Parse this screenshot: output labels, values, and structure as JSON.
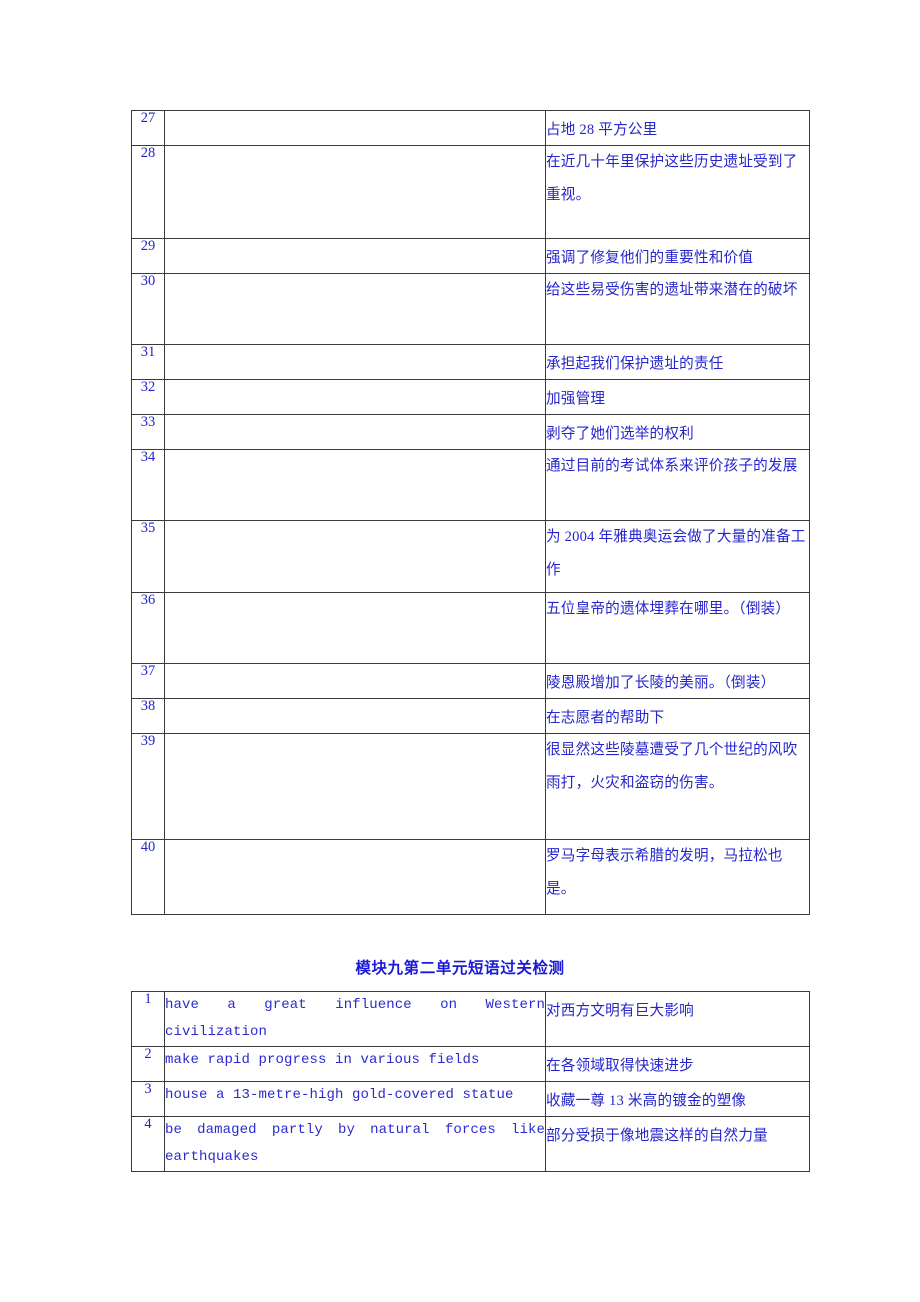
{
  "document": {
    "text_color": "#2525cc",
    "heading_color": "#1a1ad6",
    "border_color": "#3a3a3a",
    "background": "#ffffff"
  },
  "table_top": {
    "rows": [
      {
        "num": "27",
        "english": "",
        "chinese": "占地 28 平方公里"
      },
      {
        "num": "28",
        "english": "",
        "chinese": "在近几十年里保护这些历史遗址受到了重视。"
      },
      {
        "num": "29",
        "english": "",
        "chinese": "强调了修复他们的重要性和价值"
      },
      {
        "num": "30",
        "english": "",
        "chinese": "给这些易受伤害的遗址带来潜在的破坏"
      },
      {
        "num": "31",
        "english": "",
        "chinese": "承担起我们保护遗址的责任"
      },
      {
        "num": "32",
        "english": "",
        "chinese": "加强管理"
      },
      {
        "num": "33",
        "english": "",
        "chinese": "剥夺了她们选举的权利"
      },
      {
        "num": "34",
        "english": "",
        "chinese": "通过目前的考试体系来评价孩子的发展"
      },
      {
        "num": "35",
        "english": "",
        "chinese": "为 2004 年雅典奥运会做了大量的准备工作"
      },
      {
        "num": "36",
        "english": "",
        "chinese": "五位皇帝的遗体埋葬在哪里。（倒装）"
      },
      {
        "num": "37",
        "english": "",
        "chinese": "陵恩殿增加了长陵的美丽。（倒装）"
      },
      {
        "num": "38",
        "english": "",
        "chinese": "在志愿者的帮助下"
      },
      {
        "num": "39",
        "english": "",
        "chinese": "很显然这些陵墓遭受了几个世纪的风吹雨打，火灾和盗窃的伤害。"
      },
      {
        "num": "40",
        "english": "",
        "chinese": "罗马字母表示希腊的发明，马拉松也是。"
      }
    ]
  },
  "heading": {
    "text": "模块九第二单元短语过关检测"
  },
  "table_bottom": {
    "rows": [
      {
        "num": "1",
        "english_lines": [
          "have a great influence on Western civilization"
        ],
        "chinese": "对西方文明有巨大影响"
      },
      {
        "num": "2",
        "english_lines": [
          "make rapid progress in various fields"
        ],
        "chinese": "在各领域取得快速进步"
      },
      {
        "num": "3",
        "english_lines": [
          "house a 13-metre-high gold-covered statue"
        ],
        "chinese": "收藏一尊 13 米高的镀金的塑像"
      },
      {
        "num": "4",
        "english_lines": [
          "be damaged partly by natural forces like",
          "earthquakes"
        ],
        "chinese": "部分受损于像地震这样的自然力量"
      }
    ]
  }
}
